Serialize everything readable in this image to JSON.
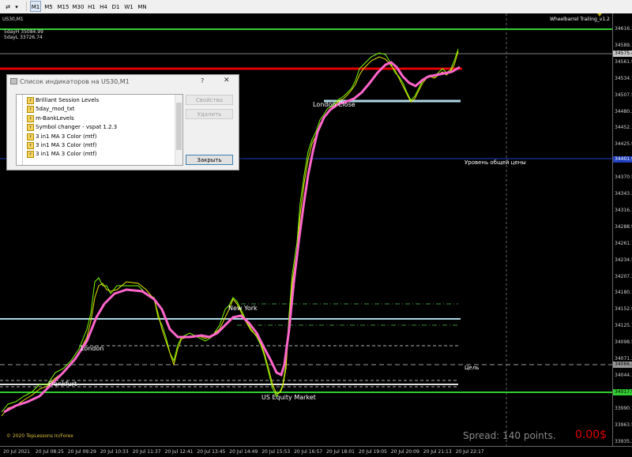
{
  "toolbar": {
    "timeframes": [
      "M1",
      "M5",
      "M15",
      "M30",
      "H1",
      "H4",
      "D1",
      "W1",
      "MN"
    ],
    "active_timeframe": "M1"
  },
  "chart": {
    "symbol_label": "US30,M1",
    "indicator_name": "Wheelbarrel Trailing_v1.2",
    "day_high_label": "5dayH 35084.99",
    "day_low_label": "5dayL 33726.74",
    "sessions": {
      "london_close": "London Close",
      "new_york": "New York",
      "london": "London",
      "frankfurt": "Frankfurt",
      "us_equity": "US Equity Market"
    },
    "common_price_level_label": "Уровень общей цены",
    "target_label": "Цель",
    "copyright": "© 2020 TopLessons In/Forex",
    "spread_label": "Spread: 140 points.",
    "profit_label": "0.00$",
    "colors": {
      "green_line": "#32cd32",
      "red_line": "#e00000",
      "blue_line": "#1f3fbf",
      "lightblue_line": "#add8e6",
      "ma_pink": "#ff66cc",
      "price_yellow": "#e6e600",
      "price_green": "#7fff00",
      "profit_red": "#e00000"
    }
  },
  "price_axis": {
    "ticks": [
      "34616.33",
      "34589.13",
      "34561.93",
      "34534.73",
      "34507.53",
      "34480.33",
      "34452.13",
      "34425.93",
      "34398.73",
      "34370.53",
      "34343.33",
      "34316.13",
      "34288.93",
      "34261.73",
      "34234.53",
      "34207.33",
      "34180.13",
      "34152.93",
      "34125.73",
      "34098.53",
      "34071.33",
      "34044.13",
      "34017.93",
      "33990.73",
      "33963.53",
      "33935.33"
    ],
    "tags": {
      "current": "34575.4",
      "blue_level": "34401.9",
      "gray_level": "34066.2",
      "green_low": "34017.9"
    }
  },
  "time_axis": {
    "ticks": [
      "20 Jul 2021",
      "20 Jul 08:25",
      "20 Jul 09:29",
      "20 Jul 10:33",
      "20 Jul 11:37",
      "20 Jul 12:41",
      "20 Jul 13:45",
      "20 Jul 14:49",
      "20 Jul 15:53",
      "20 Jul 16:57",
      "20 Jul 18:01",
      "20 Jul 19:05",
      "20 Jul 20:09",
      "20 Jul 21:13",
      "20 Jul 22:17"
    ]
  },
  "dialog": {
    "title": "Список индикаторов на US30,M1",
    "help": "?",
    "close_glyph": "✕",
    "fx_glyph": "f",
    "items": [
      "Brilliant Session Levels",
      "5day_mod_txt",
      "m-BankLevels",
      "Symbol changer - vspat 1.2.3",
      "3 in1 MA 3 Color (mtf)",
      "3 in1 MA 3 Color (mtf)",
      "3 in1 MA 3 Color (mtf)"
    ],
    "properties_button": "Свойства",
    "delete_button": "Удалить",
    "close_button": "Закрыть"
  }
}
